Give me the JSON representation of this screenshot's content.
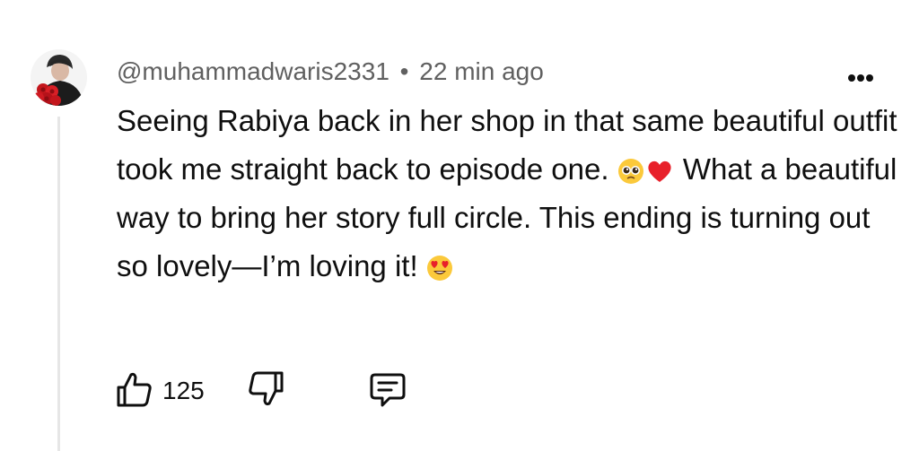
{
  "comment": {
    "author": "@muhammadwaris2331",
    "separator": "•",
    "time": "22 min ago",
    "text_segments": [
      "Seeing Rabiya back in her shop in that same beautiful outfit took me straight back to episode one. ",
      " What a beautiful way to bring her story full circle. This ending is turning out so lovely—I’m loving it! "
    ],
    "emojis": [
      "pleading-face-emoji",
      "red-heart-emoji",
      "heart-eyes-emoji"
    ]
  },
  "actions": {
    "like_count": "125",
    "icons": [
      "thumbs-up-icon",
      "thumbs-down-icon",
      "reply-icon",
      "more-vertical-icon"
    ]
  },
  "colors": {
    "text": "#0f0f0f",
    "meta": "#606060",
    "thread_line": "#e6e6e6"
  }
}
